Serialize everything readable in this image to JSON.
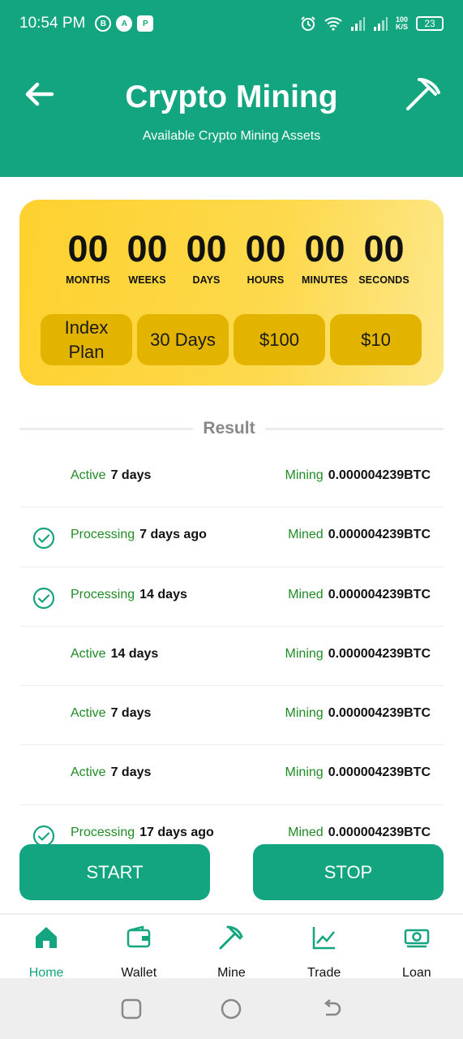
{
  "status_bar": {
    "time": "10:54 PM",
    "left_icons": [
      "B",
      "A",
      "P"
    ],
    "speed_top": "100",
    "speed_bottom": "K/S",
    "battery": "23"
  },
  "header": {
    "title": "Crypto Mining",
    "subtitle": "Available Crypto Mining Assets"
  },
  "timer": {
    "units": [
      {
        "value": "00",
        "label": "MONTHS"
      },
      {
        "value": "00",
        "label": "WEEKS"
      },
      {
        "value": "00",
        "label": "DAYS"
      },
      {
        "value": "00",
        "label": "HOURS"
      },
      {
        "value": "00",
        "label": "MINUTES"
      },
      {
        "value": "00",
        "label": "SECONDS"
      }
    ],
    "plan": [
      "Index Plan",
      "30 Days",
      "$100",
      "$10"
    ]
  },
  "result_label": "Result",
  "rows": [
    {
      "icon": "",
      "status": "Active",
      "duration": "7 days",
      "state": "Mining",
      "amount": "0.000004239BTC"
    },
    {
      "icon": "check-circle-icon",
      "status": "Processing",
      "duration": "7 days ago",
      "state": "Mined",
      "amount": "0.000004239BTC"
    },
    {
      "icon": "check-circle-icon",
      "status": "Processing",
      "duration": "14 days",
      "state": "Mined",
      "amount": "0.000004239BTC"
    },
    {
      "icon": "",
      "status": "Active",
      "duration": "14 days",
      "state": "Mining",
      "amount": "0.000004239BTC"
    },
    {
      "icon": "",
      "status": "Active",
      "duration": "7 days",
      "state": "Mining",
      "amount": "0.000004239BTC"
    },
    {
      "icon": "",
      "status": "Active",
      "duration": "7 days",
      "state": "Mining",
      "amount": "0.000004239BTC"
    },
    {
      "icon": "check-circle-icon",
      "status": "Processing",
      "duration": "17 days ago",
      "state": "Mined",
      "amount": "0.000004239BTC"
    }
  ],
  "buttons": {
    "start": "START",
    "stop": "STOP"
  },
  "nav": [
    {
      "label": "Home",
      "icon": "home-icon",
      "active": true
    },
    {
      "label": "Wallet",
      "icon": "wallet-icon",
      "active": false
    },
    {
      "label": "Mine",
      "icon": "pickaxe-icon",
      "active": false
    },
    {
      "label": "Trade",
      "icon": "chart-icon",
      "active": false
    },
    {
      "label": "Loan",
      "icon": "cash-icon",
      "active": false
    }
  ],
  "colors": {
    "primary": "#13a57f",
    "accent": "#fdd12e",
    "status_green": "#1f8b24"
  }
}
